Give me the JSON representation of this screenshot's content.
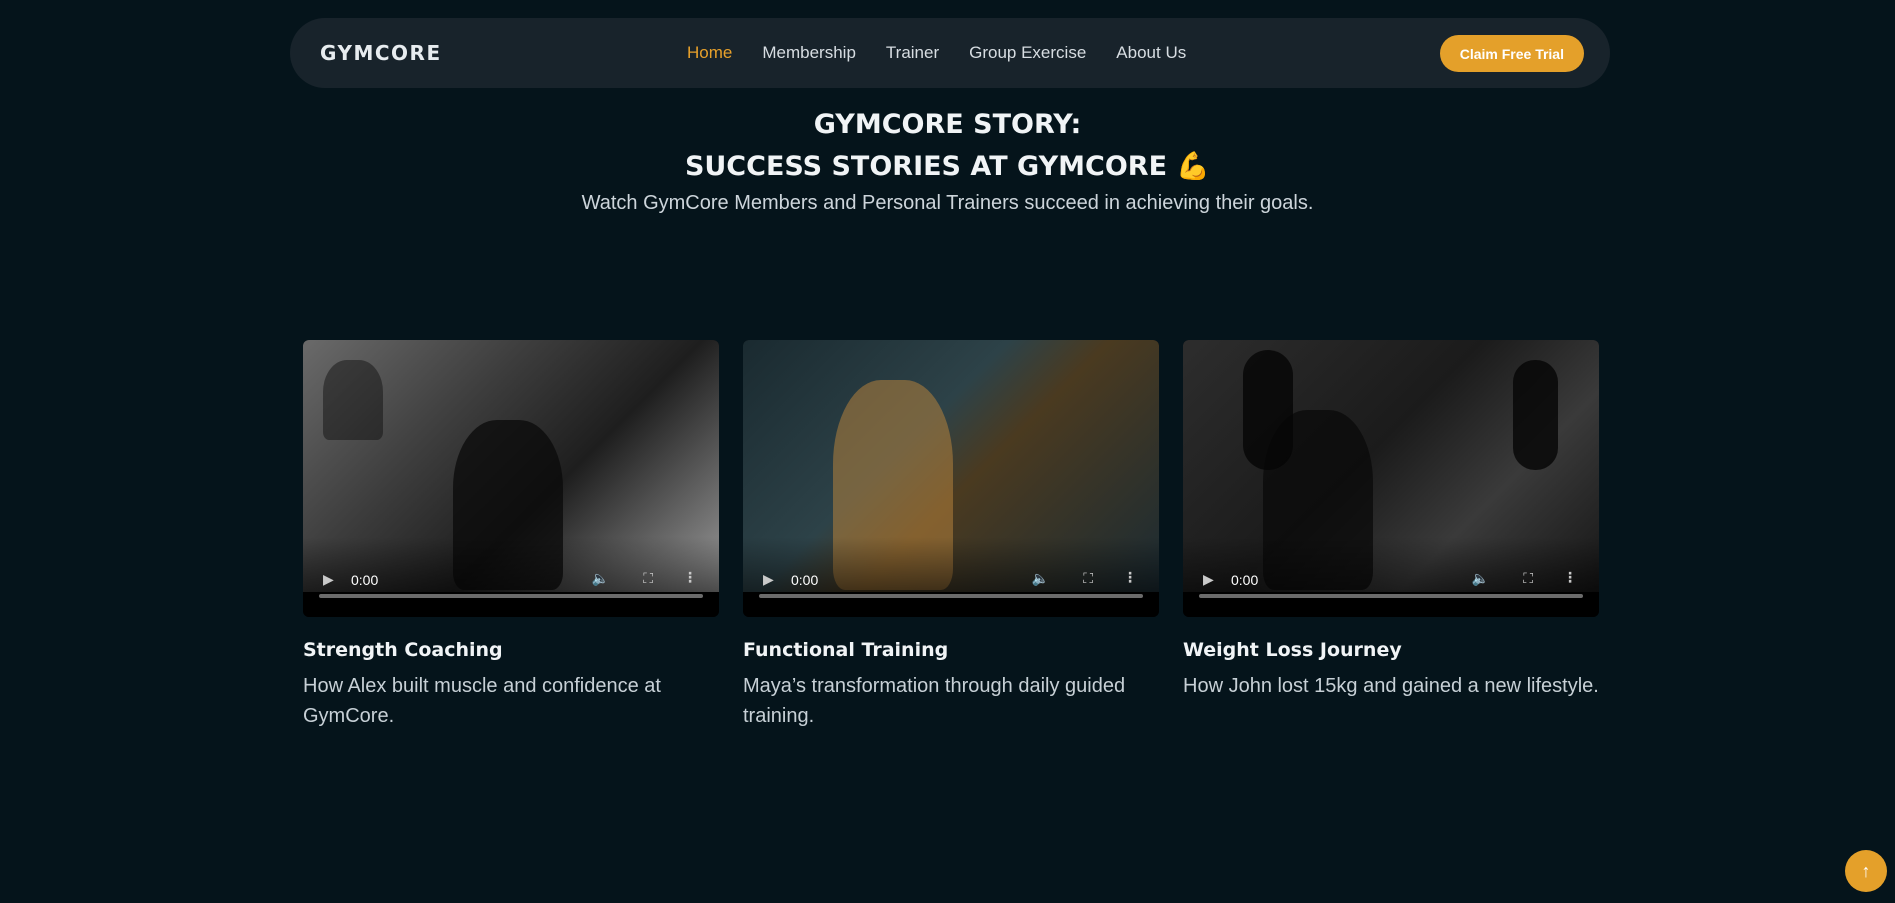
{
  "nav": {
    "brand": "GYMCORE",
    "items": [
      {
        "label": "Home",
        "active": true
      },
      {
        "label": "Membership"
      },
      {
        "label": "Trainer"
      },
      {
        "label": "Group Exercise"
      },
      {
        "label": "About Us"
      }
    ],
    "cta_label": "Claim Free Trial"
  },
  "hero": {
    "title_line1": "GYMCORE STORY:",
    "title_line2": "SUCCESS STORIES AT GYMCORE",
    "title_emoji": "💪",
    "subtitle": "Watch GymCore Members and Personal Trainers succeed in achieving their goals."
  },
  "cards": [
    {
      "title": "Strength Coaching",
      "desc": "How Alex built muscle and confidence at GymCore.",
      "time": "0:00"
    },
    {
      "title": "Functional Training",
      "desc": "Maya’s transformation through daily guided training.",
      "time": "0:00"
    },
    {
      "title": "Weight Loss Journey",
      "desc": "How John lost 15kg and gained a new lifestyle.",
      "time": "0:00"
    }
  ],
  "video_controls": {
    "play_icon": "play-icon",
    "volume_icon": "volume-icon",
    "fullscreen_icon": "fullscreen-icon",
    "more_icon": "more-options-icon"
  },
  "scroll_top": {
    "icon": "arrow-up-icon"
  },
  "colors": {
    "background": "#05141b",
    "nav_bg": "#18232b",
    "accent": "#e4a02a",
    "text": "#e9edf0"
  }
}
